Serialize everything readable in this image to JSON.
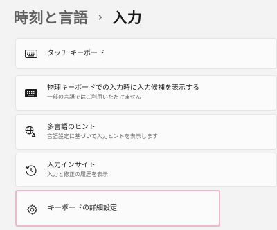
{
  "breadcrumb": {
    "parent": "時刻と言語",
    "separator": "›",
    "current": "入力"
  },
  "settings": [
    {
      "id": "touch-keyboard",
      "title": "タッチ キーボード",
      "desc": "",
      "icon": "keyboard-icon"
    },
    {
      "id": "physical-keyboard",
      "title": "物理キーボードでの入力時に入力候補を表示する",
      "desc": "一部の言語ではご利用いただけません",
      "icon": "keyboard-icon"
    },
    {
      "id": "multilingual",
      "title": "多言語のヒント",
      "desc": "言語設定に基づいて入力ヒントを表示します",
      "icon": "language-icon"
    },
    {
      "id": "insights",
      "title": "入力インサイト",
      "desc": "入力と修正の履歴を表示",
      "icon": "history-icon"
    },
    {
      "id": "advanced-keyboard",
      "title": "キーボードの詳細設定",
      "desc": "",
      "icon": "gear-icon"
    }
  ],
  "colors": {
    "highlight_border": "#f3b6cb",
    "background": "#f3f3f3",
    "card": "#fbfbfb"
  }
}
